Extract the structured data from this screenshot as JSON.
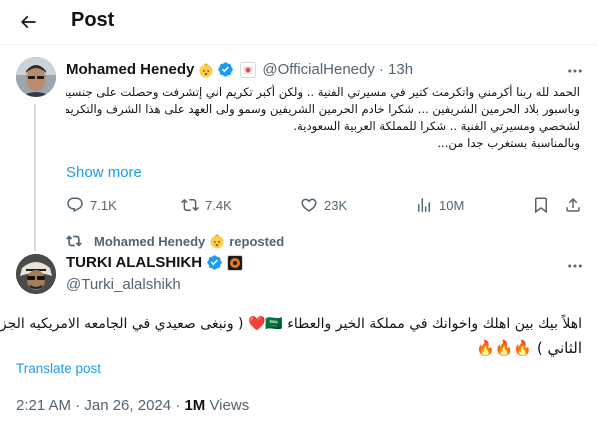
{
  "header": {
    "title": "Post"
  },
  "quoted_tweet": {
    "name": "Mohamed Henedy",
    "handle": "@OfficialHenedy",
    "time": "· 13h",
    "text_lines": [
      "الحمد لله ربنا أكرمني واتكرمت كتير في مسيرتي الفنية .. ولكن أكبر تكريم اني إتشرفت وحصلت على جنسية",
      "وباسبور بلاد الحرمين الشريفين ... شكرا خادم الحرمين الشريفين وسمو ولى العهد على هذا الشرف والتكريم",
      "لشخصي ومسيرتي الفنية .. شكرا للمملكة العربية السعودية.",
      "وبالمناسبة بستغرب جدا من..."
    ],
    "show_more": "Show more",
    "stats": {
      "replies": "7.1K",
      "reposts": "7.4K",
      "likes": "23K",
      "views": "10M"
    }
  },
  "repost_label": {
    "name": "Mohamed Henedy",
    "suffix": "reposted"
  },
  "main_tweet": {
    "name": "TURKI ALALSHIKH",
    "handle": "@Turki_alalshikh",
    "line1": "اهلاً بيك بين اهلك واخوانك في مملكة الخير والعطاء 🇸🇦❤️ ( ونبغى صعيدي في الجامعه الامريكيه الجزء",
    "line2": "الثاني ) 🔥🔥🔥",
    "translate": "Translate post",
    "date": "2:21 AM · Jan 26, 2024 · ",
    "views_count": "1M",
    "views_label": " Views"
  },
  "colors": {
    "accent": "#1d9bf0",
    "secondary_text": "#536471",
    "primary_text": "#0f1419",
    "border": "#eff3f4"
  },
  "icons": [
    "back-arrow-icon",
    "verified-badge-icon",
    "more-dots-icon",
    "reply-icon",
    "repost-icon",
    "like-icon",
    "views-icon",
    "bookmark-icon",
    "share-icon"
  ]
}
